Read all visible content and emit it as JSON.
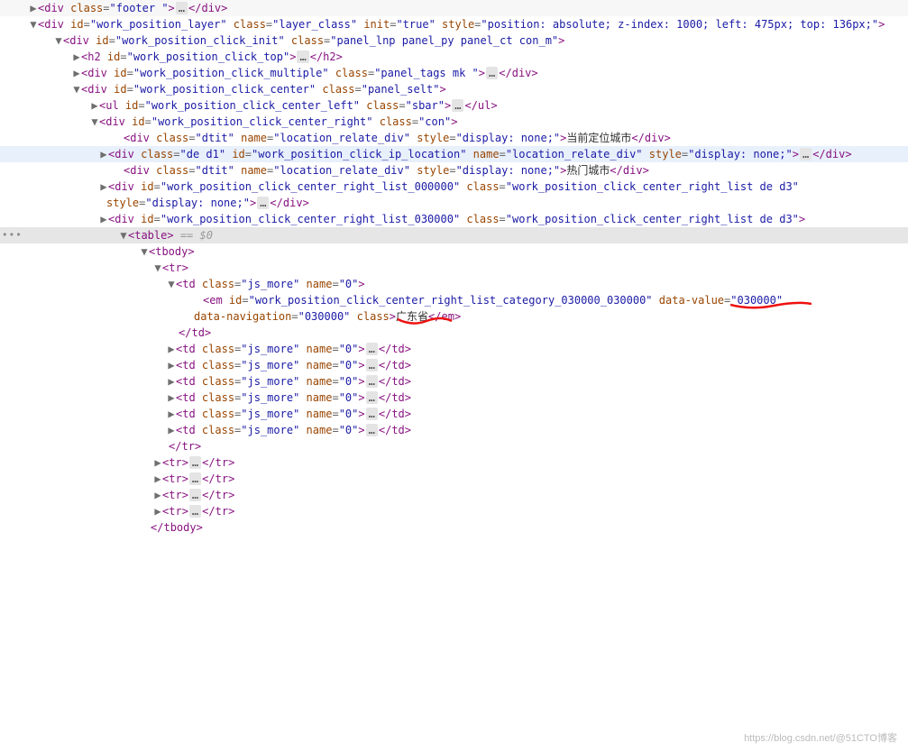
{
  "lines": {
    "l0": {
      "indent": 32,
      "arrow": "right",
      "open": "<div class=\"footer \">",
      "mid": "…",
      "close": "</div>"
    },
    "l1": {
      "indent": 32,
      "arrow": "down",
      "open": "<div id=\"work_position_layer\" class=\"layer_class\" init=\"true\" style=\"position: absolute; z-index: 1000; left: 475px; top: 136px;\">",
      "wrapIndent": 40
    },
    "l2": {
      "indent": 60,
      "arrow": "down",
      "open": "<div id=\"work_position_click_init\" class=\"panel_lnp panel_py panel_ct con_m\">"
    },
    "l3": {
      "indent": 80,
      "arrow": "right",
      "open": "<h2 id=\"work_position_click_top\">",
      "mid": "…",
      "close": "</h2>"
    },
    "l4": {
      "indent": 80,
      "arrow": "right",
      "open": "<div id=\"work_position_click_multiple\" class=\"panel_tags mk \">",
      "mid": "…",
      "close": "</div>"
    },
    "l5": {
      "indent": 80,
      "arrow": "down",
      "open": "<div id=\"work_position_click_center\" class=\"panel_selt\">"
    },
    "l6": {
      "indent": 100,
      "arrow": "right",
      "open": "<ul id=\"work_position_click_center_left\" class=\"sbar\">",
      "mid": "…",
      "close": "</ul>"
    },
    "l7": {
      "indent": 100,
      "arrow": "down",
      "open": "<div id=\"work_position_click_center_right\" class=\"con\">"
    },
    "l8": {
      "indent": 127,
      "arrow": "",
      "open": "<div class=\"dtit\" name=\"location_relate_div\" style=\"display: none;\">",
      "text": "当前定位城市",
      "close": "</div>"
    },
    "l9": {
      "indent": 110,
      "arrow": "right",
      "open": "<div class=\"de d1\" id=\"work_position_click_ip_location\" name=\"location_relate_div\" style=\"display: none;\">",
      "mid": "…",
      "close": "</div>",
      "wrapIndent": 110,
      "highlight": true
    },
    "l10": {
      "indent": 127,
      "arrow": "",
      "open": "<div class=\"dtit\" name=\"location_relate_div\" style=\"display: none;\">",
      "text": "热门城市",
      "close": "</div>"
    },
    "l11": {
      "indent": 110,
      "arrow": "right",
      "open": "<div id=\"work_position_click_center_right_list_000000\" class=\"work_position_click_center_right_list de d3\" style=\"display: none;\">",
      "mid": "…",
      "close": "</div>",
      "wrapIndent": 118
    },
    "l12": {
      "indent": 110,
      "arrow": "right",
      "open": "<div id=\"work_position_click_center_right_list_030000\" class=\"work_position_click_center_right_list de d3\">",
      "wrapIndent": 118
    },
    "l13": {
      "indent": 132,
      "arrow": "down",
      "open": "<table>",
      "after": " == $0",
      "selected": true,
      "gutterDots": true
    },
    "l14": {
      "indent": 155,
      "arrow": "down",
      "open": "<tbody>"
    },
    "l15": {
      "indent": 170,
      "arrow": "down",
      "open": "<tr>"
    },
    "l16": {
      "indent": 185,
      "arrow": "down",
      "open": "<td class=\"js_more\" name=\"0\">"
    },
    "l17": {
      "indent": 215,
      "arrow": "",
      "open": "<em id=\"work_position_click_center_right_list_category_030000_030000\" data-value=\"030000\" data-navigation=\"030000\" class>",
      "text": "广东省",
      "close": "</em>",
      "wrapIndent": 215,
      "annotValue": true,
      "annotText": true
    },
    "l18": {
      "indent": 198,
      "arrow": "",
      "closeOnly": "</td>"
    },
    "l19": {
      "indent": 185,
      "arrow": "right",
      "open": "<td class=\"js_more\" name=\"0\">",
      "mid": "…",
      "close": "</td>"
    },
    "l20": {
      "indent": 185,
      "arrow": "right",
      "open": "<td class=\"js_more\" name=\"0\">",
      "mid": "…",
      "close": "</td>"
    },
    "l21": {
      "indent": 185,
      "arrow": "right",
      "open": "<td class=\"js_more\" name=\"0\">",
      "mid": "…",
      "close": "</td>"
    },
    "l22": {
      "indent": 185,
      "arrow": "right",
      "open": "<td class=\"js_more\" name=\"0\">",
      "mid": "…",
      "close": "</td>"
    },
    "l23": {
      "indent": 185,
      "arrow": "right",
      "open": "<td class=\"js_more\" name=\"0\">",
      "mid": "…",
      "close": "</td>"
    },
    "l24": {
      "indent": 185,
      "arrow": "right",
      "open": "<td class=\"js_more\" name=\"0\">",
      "mid": "…",
      "close": "</td>"
    },
    "l25": {
      "indent": 187,
      "arrow": "",
      "closeOnly": "</tr>"
    },
    "l26": {
      "indent": 170,
      "arrow": "right",
      "open": "<tr>",
      "mid": "…",
      "close": "</tr>"
    },
    "l27": {
      "indent": 170,
      "arrow": "right",
      "open": "<tr>",
      "mid": "…",
      "close": "</tr>"
    },
    "l28": {
      "indent": 170,
      "arrow": "right",
      "open": "<tr>",
      "mid": "…",
      "close": "</tr>"
    },
    "l29": {
      "indent": 170,
      "arrow": "right",
      "open": "<tr>",
      "mid": "…",
      "close": "</tr>"
    },
    "l30": {
      "indent": 167,
      "arrow": "",
      "closeOnly": "</tbody>"
    }
  },
  "watermark": "https://blog.csdn.net/@51CTO博客"
}
